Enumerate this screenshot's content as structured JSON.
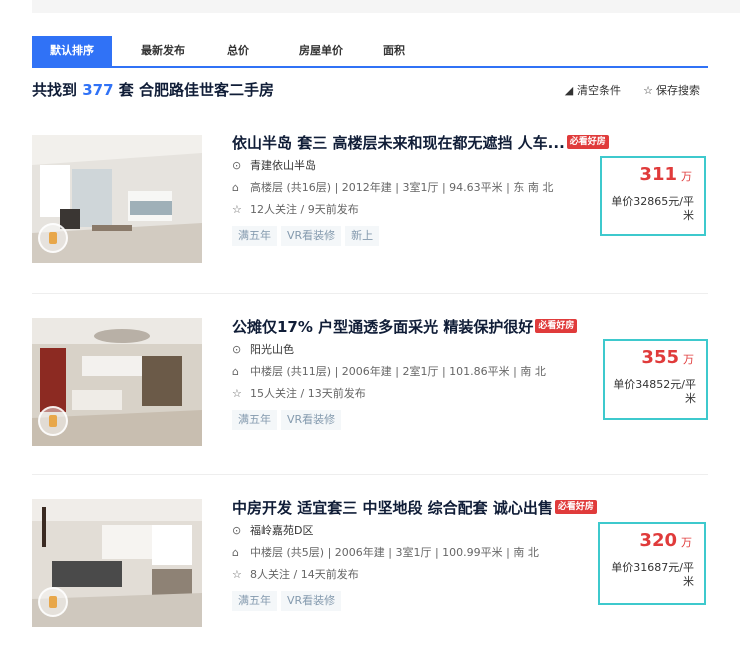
{
  "sort_tabs": [
    "默认排序",
    "最新发布",
    "总价",
    "房屋单价",
    "面积"
  ],
  "summary": {
    "prefix": "共找到",
    "count": "377",
    "suffix": "套 合肥路佳世客二手房"
  },
  "tools": {
    "clear_label": "清空条件",
    "save_label": "保存搜索"
  },
  "icons": {
    "clear": "eraser-icon",
    "save": "star-outline-icon",
    "location": "location-pin-icon",
    "house": "house-icon",
    "follow": "star-outline-icon",
    "vr": "vr-badge-icon"
  },
  "colors": {
    "accent": "#3072f6",
    "price": "#e03b3b",
    "highlight_box": "#3ec9cd",
    "tag_text": "#849aae"
  },
  "listings": [
    {
      "title": "依山半岛 套三 高楼层未来和现在都无遮挡 人车...",
      "badge": "必看好房",
      "community": "青建依山半岛",
      "house_info": "高楼层 (共16层) | 2012年建 | 3室1厅 | 94.63平米 | 东 南 北",
      "follow_info": "12人关注 / 9天前发布",
      "tags": [
        "满五年",
        "VR看装修",
        "新上"
      ],
      "price": "311",
      "price_unit": "万",
      "unit_price": "单价32865元/平米"
    },
    {
      "title": "公摊仅17% 户型通透多面采光 精装保护很好",
      "badge": "必看好房",
      "community": "阳光山色",
      "house_info": "中楼层 (共11层) | 2006年建 | 2室1厅 | 101.86平米 | 南 北",
      "follow_info": "15人关注 / 13天前发布",
      "tags": [
        "满五年",
        "VR看装修"
      ],
      "price": "355",
      "price_unit": "万",
      "unit_price": "单价34852元/平米"
    },
    {
      "title": "中房开发 适宜套三 中坚地段 综合配套 诚心出售",
      "badge": "必看好房",
      "community": "福岭嘉苑D区",
      "house_info": "中楼层 (共5层) | 2006年建 | 3室1厅 | 100.99平米 | 南 北",
      "follow_info": "8人关注 / 14天前发布",
      "tags": [
        "满五年",
        "VR看装修"
      ],
      "price": "320",
      "price_unit": "万",
      "unit_price": "单价31687元/平米"
    }
  ]
}
